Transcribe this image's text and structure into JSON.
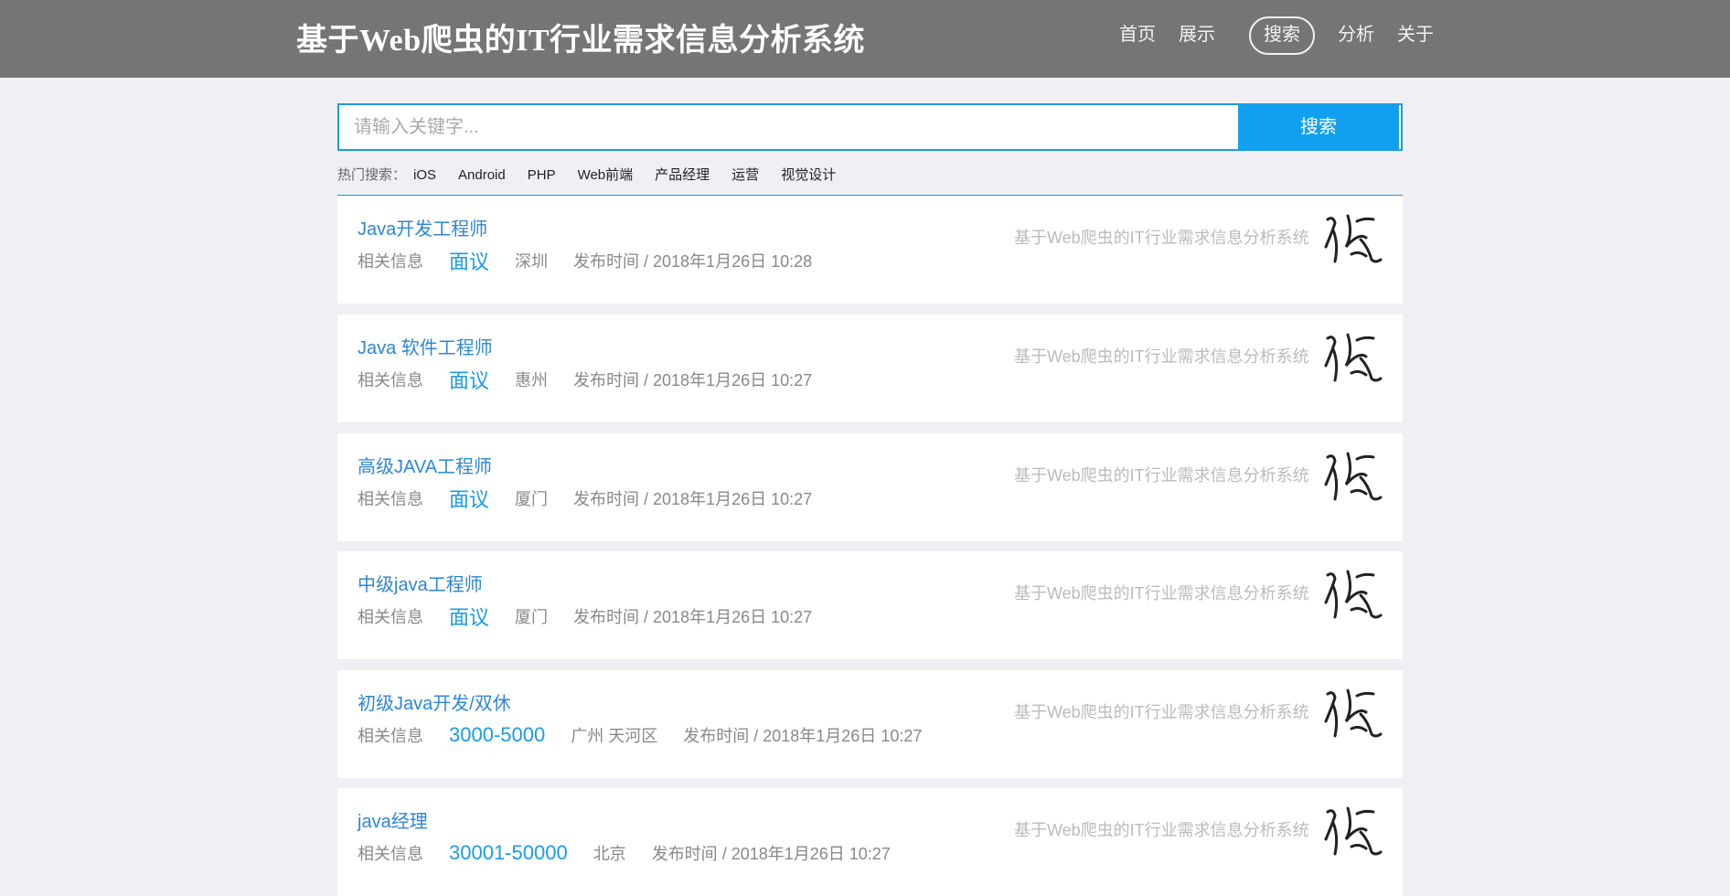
{
  "header": {
    "title": "基于Web爬虫的IT行业需求信息分析系统",
    "nav": [
      "首页",
      "展示",
      "搜索",
      "分析",
      "关于"
    ],
    "active_nav": "搜索"
  },
  "search": {
    "placeholder": "请输入关键字...",
    "value": "",
    "button_label": "搜索"
  },
  "hot": {
    "label": "热门搜索：",
    "tags": [
      "iOS",
      "Android",
      "PHP",
      "Web前端",
      "产品经理",
      "运营",
      "视觉设计"
    ]
  },
  "jobs": [
    {
      "title": "Java开发工程师",
      "info_label": "相关信息",
      "salary": "面议",
      "city": "深圳",
      "date": "发布时间 / 2018年1月26日 10:28",
      "company": "基于Web爬虫的IT行业需求信息分析系统",
      "logo_icon": "calligraphy-chen-logo-icon"
    },
    {
      "title": "Java 软件工程师",
      "info_label": "相关信息",
      "salary": "面议",
      "city": "惠州",
      "date": "发布时间 / 2018年1月26日 10:27",
      "company": "基于Web爬虫的IT行业需求信息分析系统",
      "logo_icon": "calligraphy-chen-logo-icon"
    },
    {
      "title": "高级JAVA工程师",
      "info_label": "相关信息",
      "salary": "面议",
      "city": "厦门",
      "date": "发布时间 / 2018年1月26日 10:27",
      "company": "基于Web爬虫的IT行业需求信息分析系统",
      "logo_icon": "calligraphy-chen-logo-icon"
    },
    {
      "title": "中级java工程师",
      "info_label": "相关信息",
      "salary": "面议",
      "city": "厦门",
      "date": "发布时间 / 2018年1月26日 10:27",
      "company": "基于Web爬虫的IT行业需求信息分析系统",
      "logo_icon": "calligraphy-chen-logo-icon"
    },
    {
      "title": "初级Java开发/双休",
      "info_label": "相关信息",
      "salary": "3000-5000",
      "city": "广州 天河区",
      "date": "发布时间 / 2018年1月26日 10:27",
      "company": "基于Web爬虫的IT行业需求信息分析系统",
      "logo_icon": "calligraphy-chen-logo-icon"
    },
    {
      "title": "java经理",
      "info_label": "相关信息",
      "salary": "30001-50000",
      "city": "北京",
      "date": "发布时间 / 2018年1月26日 10:27",
      "company": "基于Web爬虫的IT行业需求信息分析系统",
      "logo_icon": "calligraphy-chen-logo-icon"
    }
  ],
  "colors": {
    "header_bg": "#757575",
    "accent": "#11a0f0",
    "title_link": "#2e86d6",
    "page_bg": "#efeff4"
  }
}
